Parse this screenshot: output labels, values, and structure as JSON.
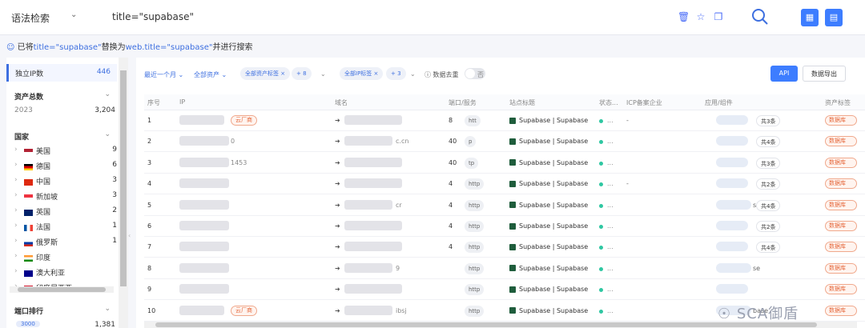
{
  "topbar": {
    "mode_label": "语法检索",
    "query": "title=\"supabase\""
  },
  "hint": {
    "prefix": "已将",
    "from": "title=\"supabase\"",
    "mid": "替换为",
    "to": "web.title=\"supabase\"",
    "suffix": "并进行搜索"
  },
  "sidebar": {
    "unique_ip_label": "独立IP数",
    "unique_ip_value": "446",
    "asset_total_label": "资产总数",
    "year_label": "2023",
    "year_value": "3,204",
    "country_label": "国家",
    "countries": [
      {
        "name": "美国",
        "count": "9"
      },
      {
        "name": "德国",
        "count": "6"
      },
      {
        "name": "中国",
        "count": "3"
      },
      {
        "name": "新加坡",
        "count": "3"
      },
      {
        "name": "英国",
        "count": "2"
      },
      {
        "name": "法国",
        "count": "1"
      },
      {
        "name": "俄罗斯",
        "count": "1"
      },
      {
        "name": "印度",
        "count": ""
      },
      {
        "name": "澳大利亚",
        "count": ""
      },
      {
        "name": "印度尼西亚",
        "count": ""
      }
    ],
    "port_rank_label": "端口排行",
    "port_first": "3000",
    "port_first_value": "1,381"
  },
  "filters": {
    "time": "最近一个月",
    "assets": "全部资产",
    "asset_tag": "全部资产标签",
    "asset_tag_more": "+ 8",
    "ip_tag": "全部IP标签",
    "ip_tag_more": "+ 3",
    "dedup_label": "数据去重",
    "dedup_state": "否",
    "api_label": "API",
    "export_label": "数据导出"
  },
  "table": {
    "headers": [
      "序号",
      "IP",
      "域名",
      "端口/服务",
      "站点标题",
      "状态...",
      "ICP备案企业",
      "应用/组件",
      "资产标签"
    ],
    "rows": [
      {
        "no": "1",
        "cloud": "云厂商",
        "port": "8",
        "svc": "htt",
        "title": "Supabase | Supabase",
        "status": "...",
        "icp": "-",
        "count": "共3条",
        "tag": "数据库"
      },
      {
        "no": "2",
        "cloud": "",
        "ip_tail": "0",
        "domain_tail": "c.cn",
        "port": "40",
        "svc": "p",
        "title": "Supabase | Supabase",
        "status": "...",
        "icp": "",
        "count": "共4条",
        "tag": "数据库"
      },
      {
        "no": "3",
        "cloud": "",
        "ip_tail": "1453",
        "port": "40",
        "svc": "tp",
        "title": "Supabase | Supabase",
        "status": "...",
        "icp": "",
        "count": "共3条",
        "tag": "数据库"
      },
      {
        "no": "4",
        "cloud": "",
        "port": "4",
        "svc": "http",
        "title": "Supabase | Supabase",
        "status": "...",
        "icp": "-",
        "count": "共2条",
        "tag": "数据库"
      },
      {
        "no": "5",
        "cloud": "",
        "domain_tail": "cr",
        "port": "4",
        "svc": "http",
        "title": "Supabase | Supabase",
        "status": "...",
        "icp": "",
        "comp_tail": "s",
        "count": "共4条",
        "tag": "数据库"
      },
      {
        "no": "6",
        "cloud": "",
        "port": "4",
        "svc": "http",
        "title": "Supabase | Supabase",
        "status": "...",
        "icp": "",
        "count": "共2条",
        "tag": "数据库"
      },
      {
        "no": "7",
        "cloud": "",
        "port": "4",
        "svc": "http",
        "title": "Supabase | Supabase",
        "status": "...",
        "icp": "",
        "count": "共4条",
        "tag": "数据库"
      },
      {
        "no": "8",
        "cloud": "",
        "domain_tail": "9",
        "port": "",
        "svc": "http",
        "title": "Supabase | Supabase",
        "status": "...",
        "icp": "",
        "comp_tail": "se",
        "count": "",
        "tag": "数据库"
      },
      {
        "no": "9",
        "cloud": "",
        "port": "",
        "svc": "http",
        "title": "Supabase | Supabase",
        "status": "...",
        "icp": "",
        "count": "",
        "tag": "数据库"
      },
      {
        "no": "10",
        "cloud": "云厂商",
        "domain_tail": "ibsj",
        "port": "",
        "svc": "http",
        "title": "Supabase | Supabase",
        "status": "...",
        "icp": "",
        "comp_tail": "base",
        "count": "",
        "tag": "数据库"
      }
    ]
  },
  "watermark": "SCA御盾"
}
